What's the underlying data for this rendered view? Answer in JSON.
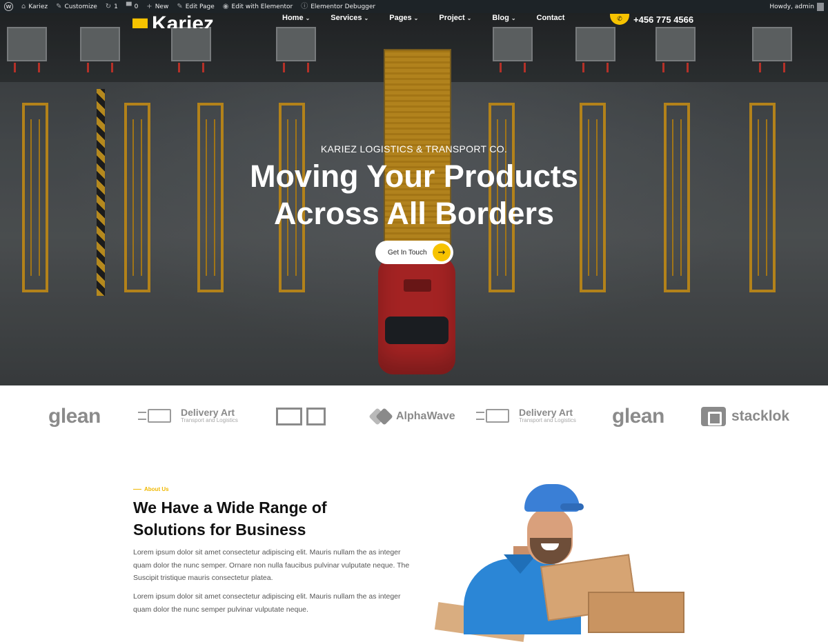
{
  "adminbar": {
    "site_name": "Kariez",
    "customize": "Customize",
    "updates_count": "1",
    "comments_count": "0",
    "new_label": "New",
    "edit_page": "Edit Page",
    "edit_elementor": "Edit with Elementor",
    "elementor_debugger": "Elementor Debugger",
    "howdy": "Howdy, admin"
  },
  "header": {
    "logo_text": "Kariez",
    "nav": [
      {
        "label": "Home",
        "has_dropdown": true
      },
      {
        "label": "Services",
        "has_dropdown": true
      },
      {
        "label": "Pages",
        "has_dropdown": true
      },
      {
        "label": "Project",
        "has_dropdown": true
      },
      {
        "label": "Blog",
        "has_dropdown": true
      },
      {
        "label": "Contact",
        "has_dropdown": false
      }
    ],
    "phone": "+456 775 4566"
  },
  "hero": {
    "eyebrow": "KARIEZ LOGISTICS & TRANSPORT CO.",
    "title_line1": "Moving Your Products",
    "title_line2": "Across All Borders",
    "cta_label": "Get In Touch"
  },
  "brands": {
    "glean": "glean",
    "delivery_art_name": "Delivery Art",
    "delivery_art_sub": "Transport and Logistics",
    "alphawave": "AlphaWave",
    "stacklok": "stacklok"
  },
  "about": {
    "eyebrow": "About Us",
    "title": "We Have a Wide Range of Solutions for Business",
    "para1": "Lorem ipsum dolor sit amet consectetur adipiscing elit. Mauris nullam the as integer quam dolor the nunc semper. Ornare non nulla faucibus pulvinar vulputate neque. The Suscipit tristique mauris consectetur platea.",
    "para2": "Lorem ipsum dolor sit amet consectetur adipiscing elit. Mauris nullam the as integer quam dolor the nunc semper pulvinar vulputate neque."
  },
  "colors": {
    "accent": "#f7c300",
    "adminbar": "#1d2327",
    "brand_gray": "#8a8a8a"
  },
  "icons": {
    "wp_logo": "wordpress-icon",
    "customize": "brush-icon",
    "updates": "refresh-icon",
    "comments": "comment-icon",
    "new": "plus-icon",
    "edit": "pencil-icon",
    "elementor": "elementor-icon",
    "debugger": "info-icon",
    "phone": "phone-icon",
    "cta": "arrow-right-icon"
  }
}
